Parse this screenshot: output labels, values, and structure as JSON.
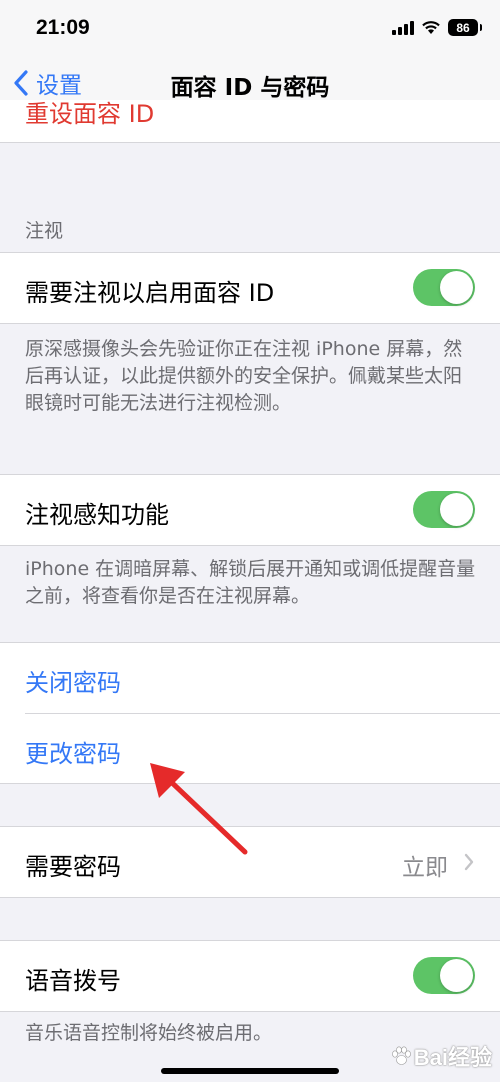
{
  "status_bar": {
    "time": "21:09",
    "battery": "86",
    "icons": [
      "signal-icon",
      "wifi-icon",
      "battery-icon"
    ]
  },
  "nav": {
    "back_label": "设置",
    "title": "面容 ID 与密码"
  },
  "clipped_cell": {
    "label": "重设面容 ID"
  },
  "attention": {
    "header": "注视",
    "require_label": "需要注视以启用面容 ID",
    "require_on": true,
    "require_footer": "原深感摄像头会先验证你正在注视 iPhone 屏幕，然后再认证，以此提供额外的安全保护。佩戴某些太阳眼镜时可能无法进行注视检测。",
    "aware_label": "注视感知功能",
    "aware_on": true,
    "aware_footer": "iPhone 在调暗屏幕、解锁后展开通知或调低提醒音量之前，将查看你是否在注视屏幕。"
  },
  "passcode": {
    "turn_off_label": "关闭密码",
    "change_label": "更改密码",
    "require_label": "需要密码",
    "require_value": "立即"
  },
  "voice_dial": {
    "label": "语音拨号",
    "on": true,
    "footer": "音乐语音控制将始终被启用。"
  },
  "watermark": {
    "text": "Bai经验"
  },
  "colors": {
    "accent": "#3478f6",
    "destructive": "#e03a31",
    "toggle_on": "#5dc466",
    "annotation": "#e52a2a"
  }
}
